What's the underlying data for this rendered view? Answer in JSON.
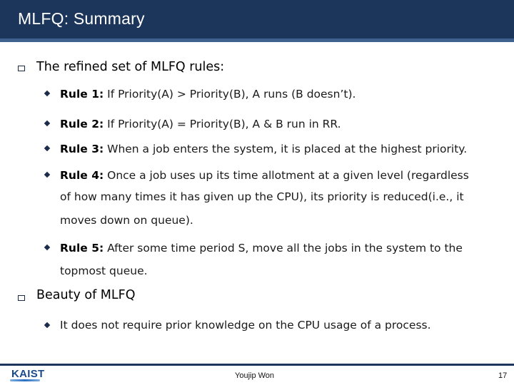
{
  "slide": {
    "title": "MLFQ: Summary",
    "sections": [
      {
        "heading": "The refined set of MLFQ rules:",
        "items": [
          {
            "label": "Rule 1:",
            "lines": [
              "If Priority(A) > Priority(B), A runs (B doesn’t)."
            ]
          },
          {
            "label": "Rule 2:",
            "lines": [
              "If Priority(A) = Priority(B), A & B run in RR."
            ]
          },
          {
            "label": "Rule 3:",
            "lines": [
              "When a job enters the system, it is placed at the highest priority."
            ]
          },
          {
            "label": "Rule 4:",
            "lines": [
              "Once a job uses up its time allotment at a given level (regardless",
              "of how many times it has given up the CPU), its priority is reduced(i.e., it",
              "moves down on queue)."
            ]
          },
          {
            "label": "Rule 5:",
            "lines": [
              "After some time period S, move all the jobs in the system to the",
              "topmost queue."
            ]
          }
        ]
      },
      {
        "heading": "Beauty of MLFQ",
        "items": [
          {
            "label": "",
            "lines": [
              "It does not require prior knowledge on the CPU usage of a process."
            ]
          }
        ]
      }
    ]
  },
  "footer": {
    "logo": "KAIST",
    "author": "Youjip Won",
    "page_number": "17"
  }
}
